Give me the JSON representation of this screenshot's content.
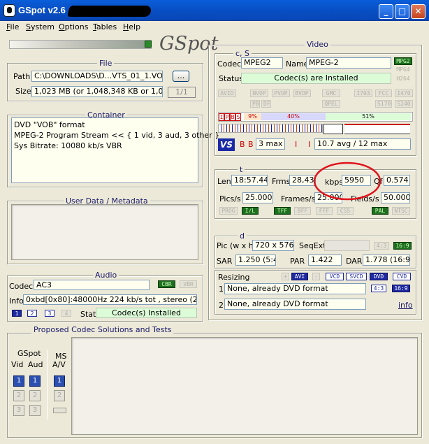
{
  "window": {
    "title": "GSpot v2.6"
  },
  "menu": [
    "File",
    "System",
    "Options",
    "Tables",
    "Help"
  ],
  "file": {
    "title": "File",
    "path_label": "Path",
    "path_value": "C:\\DOWNLOADS\\D...VTS_01_1.VOB",
    "browse_label": "...",
    "size_label": "Size",
    "size_value": "1,023 MB (or 1,048,348 KB or 1,073,50",
    "page": "1/1"
  },
  "container": {
    "title": "Container",
    "text": "DVD \"VOB\" format\nMPEG-2 Program Stream << { 1 vid, 3 aud, 3 other }\nSys Bitrate: 10080 kb/s VBR"
  },
  "userdata": {
    "title": "User Data / Metadata"
  },
  "audio": {
    "title": "Audio",
    "codec_label": "Codec",
    "codec_value": "AC3",
    "cbr": "CBR",
    "vbr": "VBR",
    "info_label": "Info",
    "info_value": "0xbd[0x80]:48000Hz  224 kb/s tot , stereo (2/0)",
    "tracks": [
      "1",
      "2",
      "3",
      "4"
    ],
    "stat_label": "Stat",
    "stat_value": "Codec(s) Installed"
  },
  "proposed": {
    "title": "Proposed Codec Solutions and Tests",
    "gspot": "GSpot",
    "vid": "Vid",
    "aud": "Aud",
    "ms": "MS",
    "av": "A/V",
    "vid_btns": [
      "1",
      "2",
      "3"
    ],
    "aud_btns": [
      "1",
      "2",
      "3"
    ],
    "ms_btns": [
      "1",
      "2"
    ]
  },
  "video": {
    "title": "Video",
    "cs_title": "c, S",
    "codec_label": "Codec",
    "codec_value": "MPEG2",
    "name_label": "Name",
    "name_value": "MPEG-2",
    "fmt_tags": [
      "MPG2",
      "MPG4",
      "H264"
    ],
    "status_label": "Status",
    "status_value": "Codec(s) are Installed",
    "flags": [
      "AVID",
      "NVOP",
      "PVOP",
      "BVOP",
      "GMC",
      "I703",
      "FCC",
      "I470",
      "PB",
      "DF",
      "QPEL",
      "S170",
      "S240"
    ],
    "frame_types": [
      "I",
      "P",
      "B",
      "S"
    ],
    "pct_i": "9%",
    "pct_p": "40%",
    "pct_b": "51%",
    "gop_labels": [
      "B",
      "B"
    ],
    "gop_max": "3 max",
    "ip_labels": [
      "I",
      "I"
    ],
    "avg": "10.7 avg / 12 max",
    "t_title": "t",
    "len_label": "Len",
    "len_value": "18:57.440",
    "frms_label": "Frms",
    "frms_value": "28,436",
    "kbps_label": "kbps",
    "kbps_value": "5950",
    "qf_label": "Qf",
    "qf_value": "0.574",
    "pics_label": "Pics/s",
    "pics_value": "25.000",
    "frames_label": "Frames/s",
    "frames_value": "25.000",
    "fields_label": "Fields/s",
    "fields_value": "50.000",
    "scan_tags": [
      "PROG",
      "I/L",
      "TFF",
      "BFF",
      "FFF",
      "CSS",
      "PAL",
      "NTSC"
    ],
    "d_title": "d",
    "pic_label": "Pic (w x h)",
    "pic_value": "720 x 576",
    "seqext_label": "SeqExt",
    "ar_tags": [
      "4:3",
      "16:9"
    ],
    "sar_label": "SAR",
    "sar_value": "1.250 (5:4)",
    "par_label": "PAR",
    "par_value": "1.422",
    "dar_label": "DAR",
    "dar_value": "1.778 (16:9)",
    "resizing_label": "Resizing",
    "resize_tags": [
      "+",
      "AVI",
      "-",
      "VCD",
      "SVCD",
      "DVD",
      "CVD"
    ],
    "line1_num": "1",
    "line1": "None, already DVD format",
    "line1_tags": [
      "4:3",
      "16:9"
    ],
    "line2_num": "2",
    "line2": "None, already DVD format",
    "info_link": "info"
  },
  "colors": {
    "titlebar": "#0a5ed9",
    "field_bg": "#fffff0",
    "green_field": "#dcfcd8",
    "highlight_circle": "#e0141c",
    "tag_on": "#1e6e20"
  }
}
